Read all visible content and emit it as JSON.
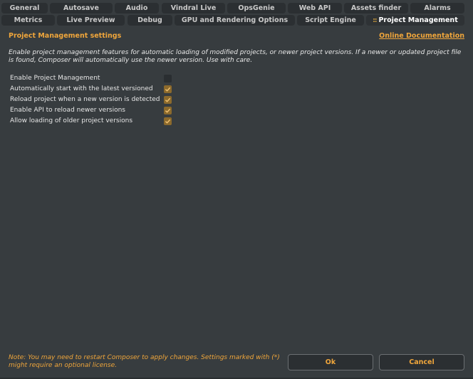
{
  "tabs_row1": [
    {
      "label": "General"
    },
    {
      "label": "Autosave"
    },
    {
      "label": "Audio"
    },
    {
      "label": "Vindral Live"
    },
    {
      "label": "OpsGenie"
    },
    {
      "label": "Web API"
    },
    {
      "label": "Assets finder"
    },
    {
      "label": "Alarms"
    }
  ],
  "tabs_row2": [
    {
      "label": "Metrics"
    },
    {
      "label": "Live Preview"
    },
    {
      "label": "Debug"
    },
    {
      "label": "GPU and Rendering Options"
    },
    {
      "label": "Script Engine"
    },
    {
      "label": "Project Management",
      "active": true,
      "grip": "::"
    }
  ],
  "header": {
    "title": "Project Management settings",
    "doc_link": "Online Documentation"
  },
  "description": "Enable project management features for automatic loading of modified projects, or newer project versions. If a newer or updated project file is found, Composer will automatically use the newer version. Use with care.",
  "options": [
    {
      "label": "Enable Project Management",
      "checked": false
    },
    {
      "label": "Automatically start with the latest versioned",
      "checked": true
    },
    {
      "label": "Reload project when a new version is detected",
      "checked": true
    },
    {
      "label": "Enable API to reload newer versions",
      "checked": true
    },
    {
      "label": "Allow loading of older project versions",
      "checked": true
    }
  ],
  "footer": {
    "note": "Note: You may need to restart Composer to apply changes. Settings marked with (*) might require an optional license.",
    "ok_label": "Ok",
    "cancel_label": "Cancel"
  },
  "colors": {
    "accent": "#f0a63b",
    "background": "#373c3f",
    "checkbox_checked": "#8c6a2c"
  }
}
